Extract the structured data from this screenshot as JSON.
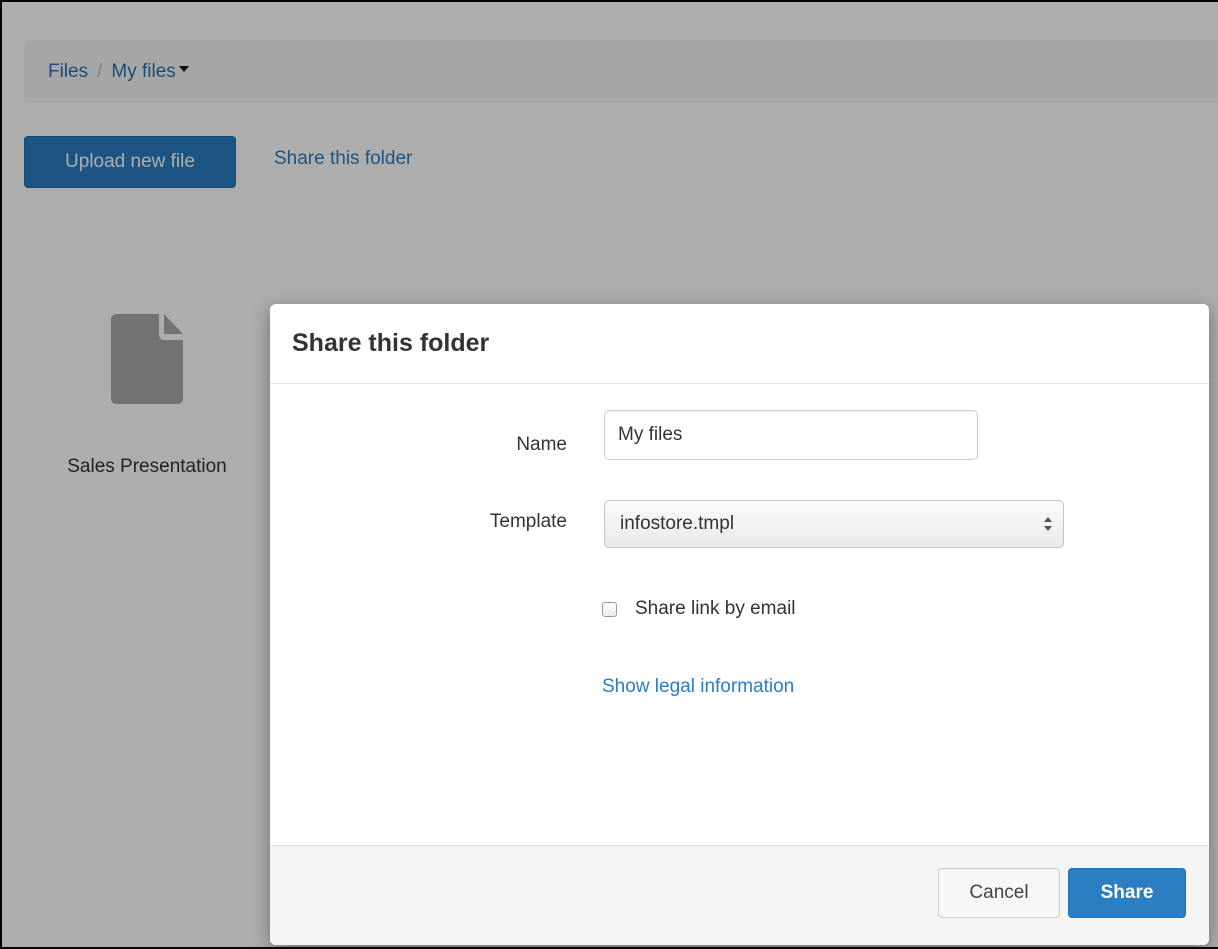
{
  "breadcrumb": {
    "root": "Files",
    "separator": "/",
    "current": "My files"
  },
  "toolbar": {
    "upload_label": "Upload new file",
    "share_folder_label": "Share this folder"
  },
  "files": [
    {
      "name": "Sales Presentation",
      "icon": "document-icon"
    }
  ],
  "colors": {
    "primary": "#2a7ec1",
    "link": "#2a7ec1",
    "backdrop": "rgba(0,0,0,0.32)"
  },
  "modal": {
    "title": "Share this folder",
    "name_label": "Name",
    "name_value": "My files",
    "template_label": "Template",
    "template_value": "infostore.tmpl",
    "checkbox_label": "Share link by email",
    "checkbox_checked": false,
    "legal_link": "Show legal information",
    "cancel_label": "Cancel",
    "share_label": "Share"
  }
}
